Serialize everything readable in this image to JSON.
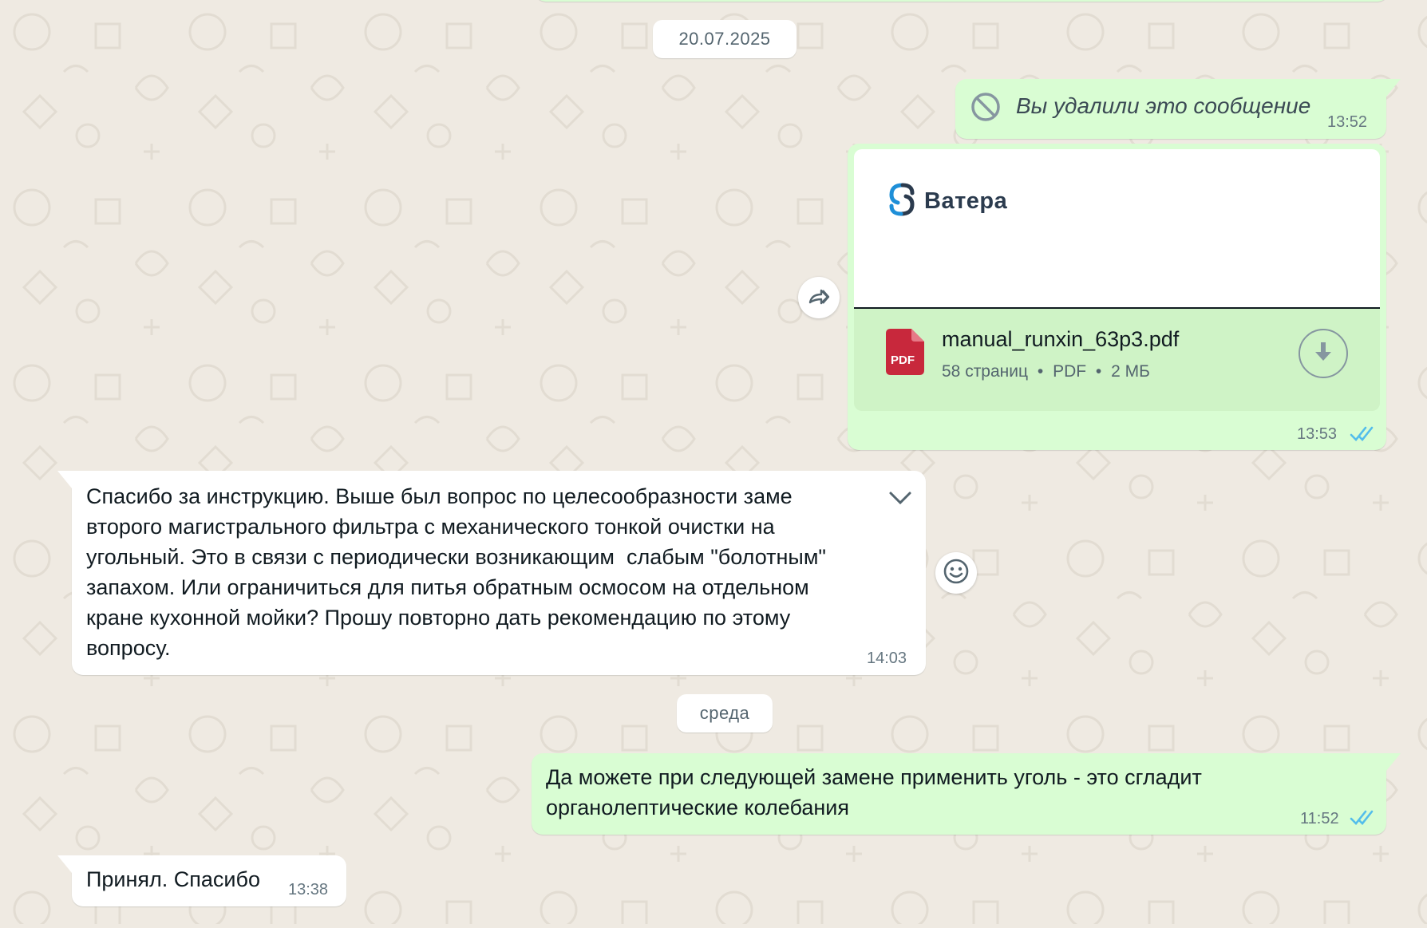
{
  "dates": {
    "first": "20.07.2025",
    "second": "среда"
  },
  "messages": {
    "deleted": {
      "text": "Вы удалили это сообщение",
      "time": "13:52"
    },
    "document": {
      "brand": "Ватера",
      "file_name": "manual_runxin_63p3.pdf",
      "meta_pages": "58 страниц",
      "meta_type": "PDF",
      "meta_size": "2 МБ",
      "file_badge": "PDF",
      "time": "13:53"
    },
    "question": {
      "text": "Спасибо за инструкцию. Выше был вопрос по целесообразности заме\nвторого магистрального фильтра с механического тонкой очистки на\nугольный. Это в связи с периодически возникающим  слабым \"болотным\"\nзапахом. Или ограничиться для питья обратным осмосом на отдельном\nкране кухонной мойки? Прошу повторно дать рекомендацию по этому\nвопросу.",
      "time": "14:03"
    },
    "answer": {
      "text": "Да можете при следующей замене применить уголь - это сгладит\nорганолептические колебания",
      "time": "11:52"
    },
    "thanks": {
      "text": "Принял. Спасибо",
      "time": "13:38"
    }
  },
  "colors": {
    "outgoing_bubble": "#d9fdd3",
    "incoming_bubble": "#ffffff",
    "read_ticks": "#53bdeb",
    "pdf_red": "#c8283c",
    "brand_blue": "#1e8fd8"
  },
  "icons": {
    "deleted": "block-icon",
    "forward": "forward-icon",
    "download": "download-icon",
    "dropdown": "chevron-down-icon",
    "reaction": "emoji-icon",
    "read_receipt": "double-check-icon"
  }
}
